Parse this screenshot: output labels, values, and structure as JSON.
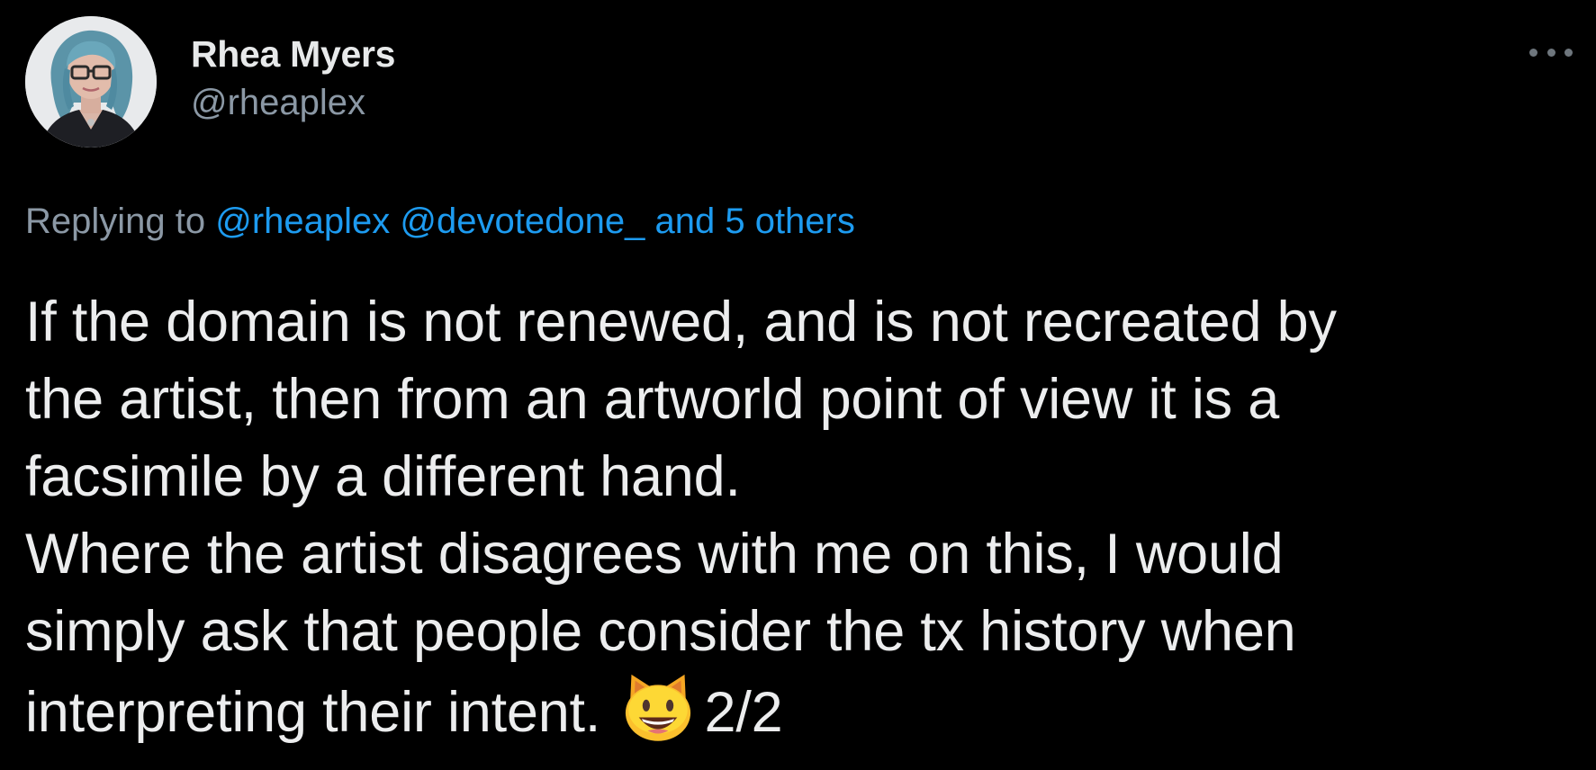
{
  "author": {
    "display_name": "Rhea Myers",
    "handle": "@rheaplex"
  },
  "reply": {
    "prefix": "Replying to",
    "mention_1": "@rheaplex",
    "mention_2": "@devotedone_",
    "others": "and 5 others"
  },
  "tweet": {
    "lines": [
      "If the domain is not renewed, and is not recreated by",
      "the artist, then from an artworld point of view it is a",
      "facsimile by a different hand.",
      "Where the artist disagrees with me on this, I would",
      "simply ask that people consider the tx history when"
    ],
    "last_line": "interpreting their intent.",
    "emoji": "smiling-cat-face-icon",
    "counter": "2/2"
  },
  "colors": {
    "background": "#000000",
    "link": "#1d9bf0",
    "secondary_text": "#8b98a5",
    "primary_text": "#e7e9ea"
  }
}
